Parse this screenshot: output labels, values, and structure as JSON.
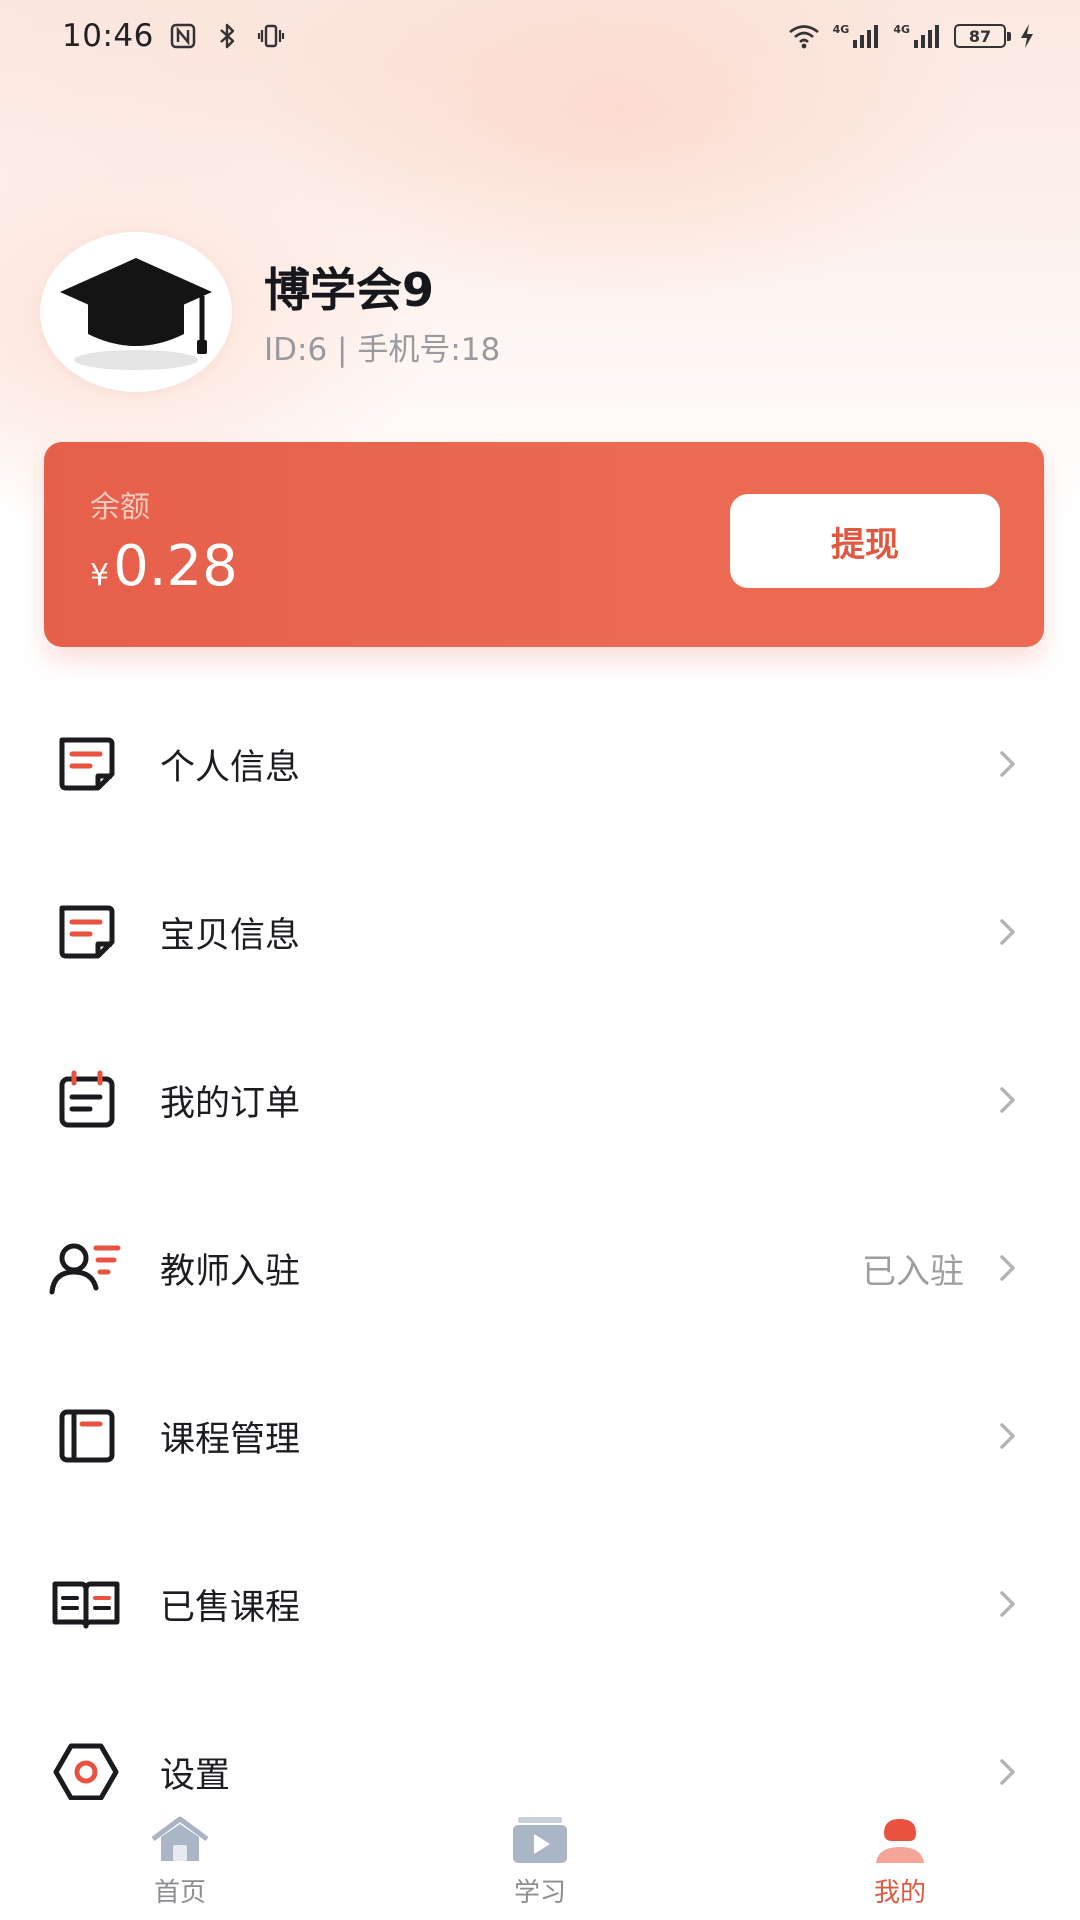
{
  "status_bar": {
    "time": "10:46",
    "battery": "87",
    "network_1": "4G",
    "network_2": "4G"
  },
  "profile": {
    "name": "博学会9",
    "meta": "ID:6 | 手机号:18"
  },
  "balance": {
    "label": "余额",
    "currency": "¥",
    "value": "0.28",
    "withdraw_label": "提现"
  },
  "menu": {
    "items": [
      {
        "label": "个人信息",
        "value": "",
        "icon": "document-icon"
      },
      {
        "label": "宝贝信息",
        "value": "",
        "icon": "document-icon"
      },
      {
        "label": "我的订单",
        "value": "",
        "icon": "calendar-note-icon"
      },
      {
        "label": "教师入驻",
        "value": "已入驻",
        "icon": "user-list-icon"
      },
      {
        "label": "课程管理",
        "value": "",
        "icon": "panel-icon"
      },
      {
        "label": "已售课程",
        "value": "",
        "icon": "open-book-icon"
      },
      {
        "label": "设置",
        "value": "",
        "icon": "hexagon-gear-icon"
      }
    ]
  },
  "bottom_nav": {
    "tabs": [
      {
        "label": "首页",
        "icon": "home-icon",
        "active": false
      },
      {
        "label": "学习",
        "icon": "play-icon",
        "active": false
      },
      {
        "label": "我的",
        "icon": "profile-icon",
        "active": true
      }
    ]
  },
  "colors": {
    "accent": "#e65f4a",
    "text_primary": "#1c1c22",
    "text_secondary": "#9a9a9e",
    "icon_dark": "#1b1b1f",
    "icon_accent": "#e8523f"
  }
}
